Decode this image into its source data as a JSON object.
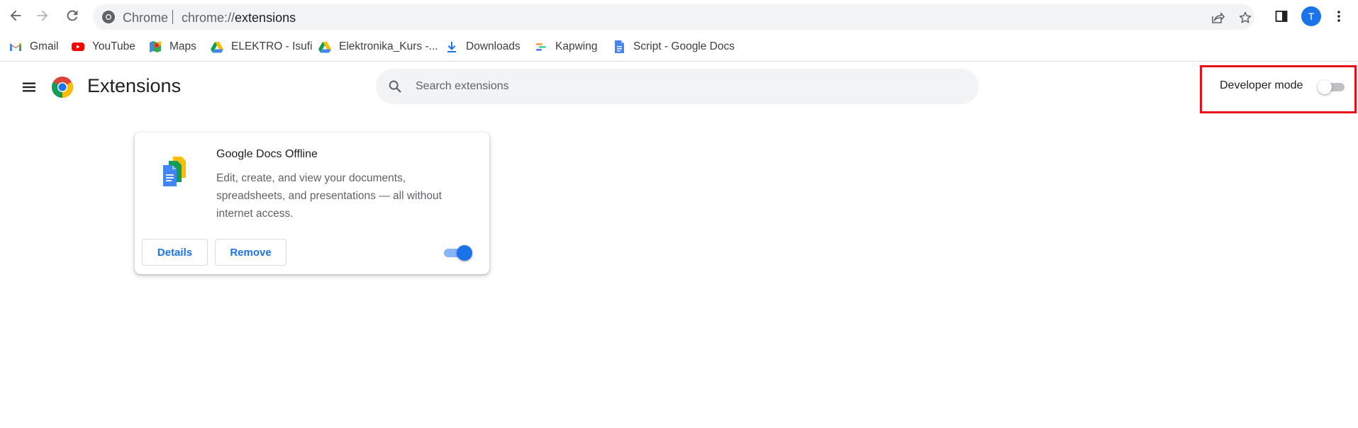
{
  "browser": {
    "omnibox": {
      "site_label": "Chrome",
      "url_scheme": "chrome://",
      "url_host": "extensions"
    },
    "profile_initial": "T"
  },
  "bookmarks": [
    {
      "label": "Gmail",
      "icon": "gmail-icon"
    },
    {
      "label": "YouTube",
      "icon": "youtube-icon"
    },
    {
      "label": "Maps",
      "icon": "maps-icon"
    },
    {
      "label": "ELEKTRO - Isufi",
      "icon": "google-drive-icon"
    },
    {
      "label": "Elektronika_Kurs -...",
      "icon": "google-drive-icon"
    },
    {
      "label": "Downloads",
      "icon": "download-icon"
    },
    {
      "label": "Kapwing",
      "icon": "kapwing-icon"
    },
    {
      "label": "Script - Google Docs",
      "icon": "google-docs-icon"
    }
  ],
  "extensions_page": {
    "title": "Extensions",
    "search_placeholder": "Search extensions",
    "developer_mode": {
      "label": "Developer mode",
      "enabled": false
    },
    "extensions": [
      {
        "name": "Google Docs Offline",
        "description": "Edit, create, and view your documents, spreadsheets, and presentations — all without internet access.",
        "details_label": "Details",
        "remove_label": "Remove",
        "enabled": true,
        "icon": "google-docs-offline-icon"
      }
    ]
  },
  "colors": {
    "accent": "#1a73e8",
    "highlight_box": "#e8111a",
    "search_bg": "#f1f3f4"
  }
}
